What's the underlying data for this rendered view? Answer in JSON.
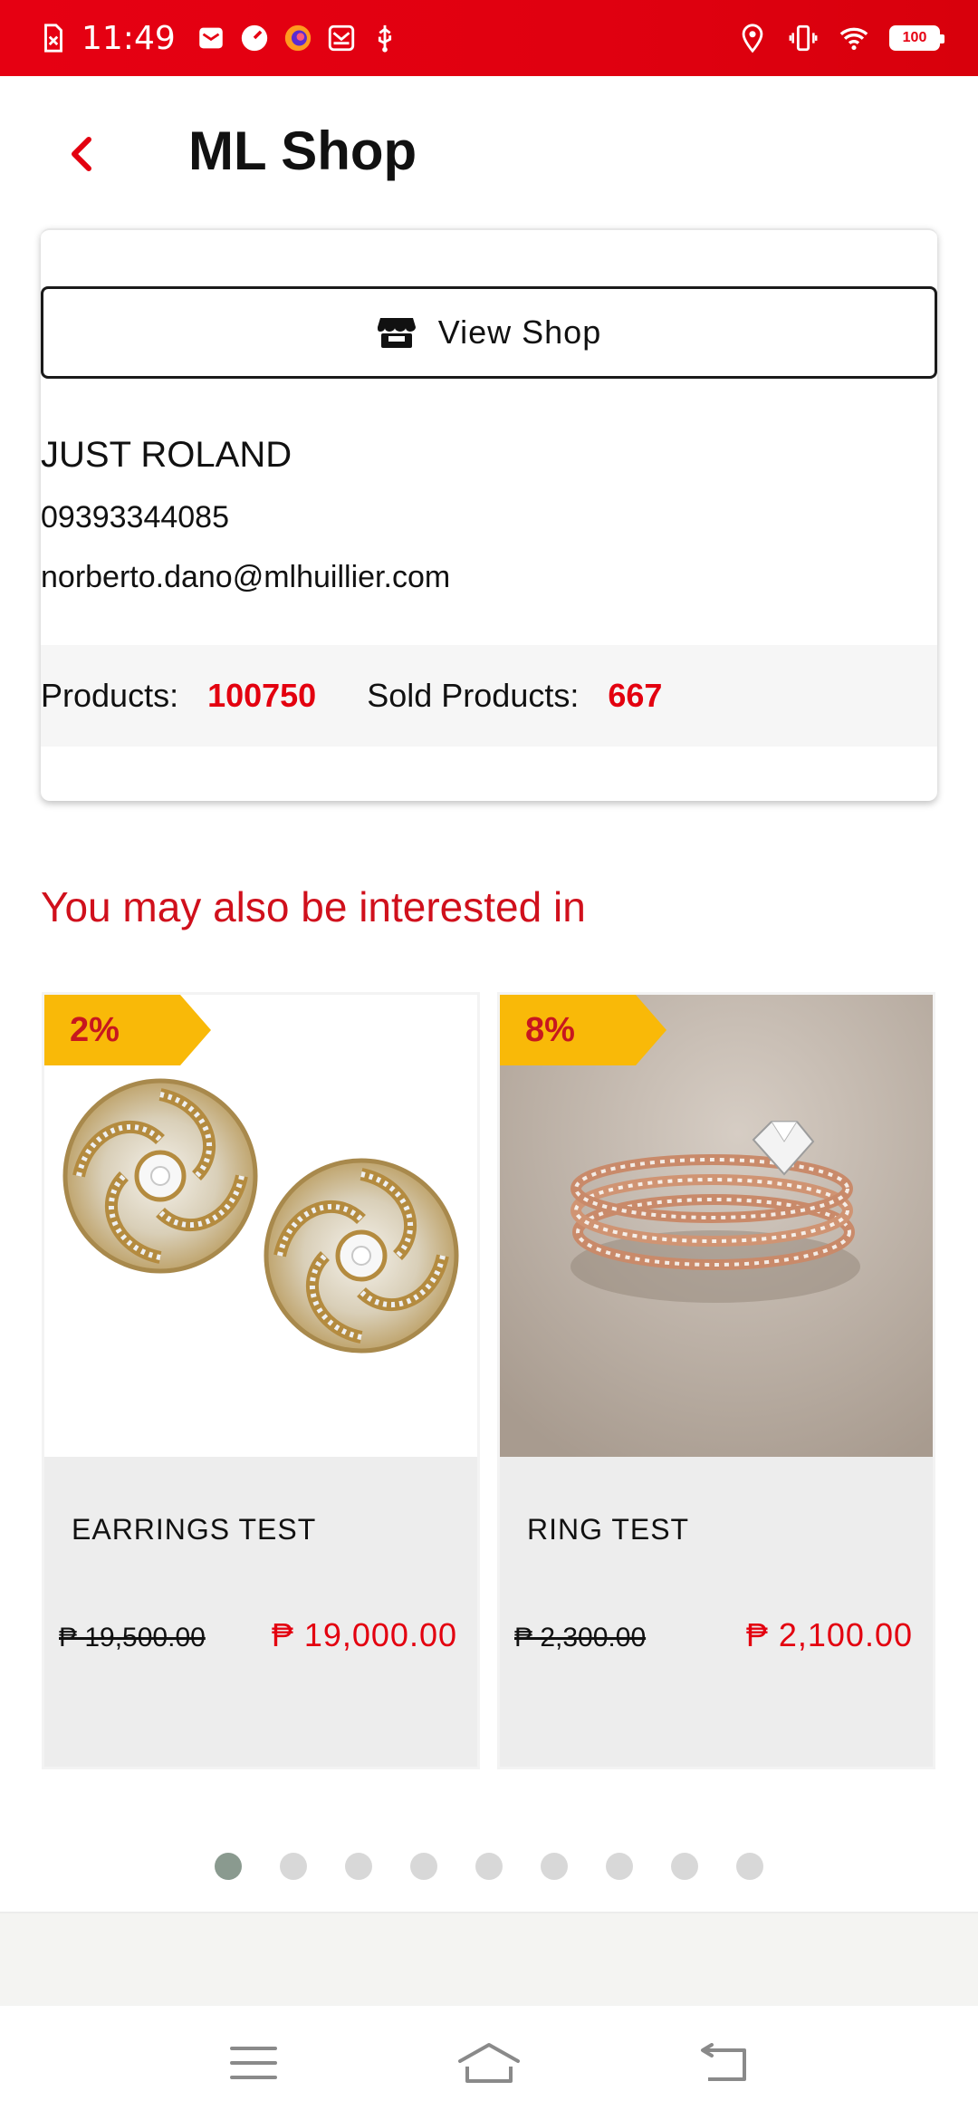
{
  "status_bar": {
    "time": "11:49",
    "battery": "100",
    "icons": [
      "sim-off-icon",
      "mail-icon",
      "speedometer-icon",
      "firefox-icon",
      "gmail-icon",
      "usb-icon",
      "location-icon",
      "vibrate-icon",
      "wifi-icon",
      "battery-icon"
    ],
    "background_color": "#e60012"
  },
  "header": {
    "title": "ML Shop",
    "back_icon": "chevron-left-icon",
    "accent_color": "#e3000f"
  },
  "shop": {
    "view_shop_label": "View Shop",
    "view_shop_icon": "store-icon",
    "name": "JUST ROLAND",
    "phone": "09393344085",
    "email": "norberto.dano@mlhuillier.com",
    "products_label": "Products:",
    "products_value": "100750",
    "sold_label": "Sold Products:",
    "sold_value": "667"
  },
  "recommendations": {
    "title": "You may also be interested in",
    "items": [
      {
        "discount": "2%",
        "name": "EARRINGS TEST",
        "old_price": "₱ 19,500.00",
        "new_price": "₱ 19,000.00",
        "image": "diamond-swirl-earrings"
      },
      {
        "discount": "8%",
        "name": "RING TEST",
        "old_price": "₱ 2,300.00",
        "new_price": "₱ 2,100.00",
        "image": "rose-gold-ring-set"
      }
    ],
    "page_count": 9,
    "active_page": 1
  },
  "nav_bar": {
    "icons": [
      "menu-icon",
      "home-icon",
      "back-icon"
    ]
  }
}
